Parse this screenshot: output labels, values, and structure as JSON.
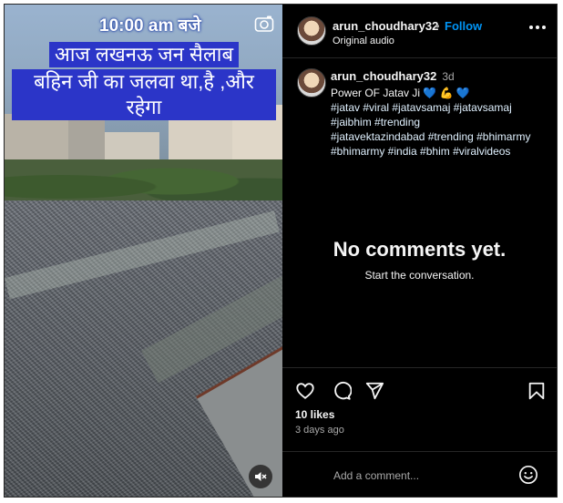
{
  "media": {
    "overlay_time": "10:00 am बजे",
    "caption_lines": [
      "आज लखनऊ जन सैलाब",
      "बहिन जी का जलवा था,है ,और रहेगा"
    ],
    "camera_icon": "camera-icon",
    "mute_icon": "speaker-muted-icon"
  },
  "header": {
    "username": "arun_choudhary32",
    "separator": "•",
    "follow_label": "Follow",
    "subtitle": "Original audio",
    "more_icon": "more-options-icon"
  },
  "caption": {
    "username": "arun_choudhary32",
    "time": "3d",
    "text": "Power OF Jatav Ji 💙 💪 💙",
    "hashtags": [
      "#jatav #viral #jatavsamaj #jatavsamaj",
      "#jaibhim #trending",
      "#jatavektazindabad #trending #bhimarmy",
      "#bhimarmy #india #bhim #viralvideos"
    ]
  },
  "comments": {
    "empty_title": "No comments yet.",
    "empty_subtitle": "Start the conversation."
  },
  "actions": {
    "like_icon": "heart-icon",
    "comment_icon": "comment-icon",
    "share_icon": "share-icon",
    "save_icon": "bookmark-icon",
    "likes": "10 likes",
    "time_ago": "3 days ago",
    "comment_placeholder": "Add a comment...",
    "emoji_icon": "emoji-icon"
  },
  "colors": {
    "accent": "#0095f6",
    "hashtag": "#e0f1ff",
    "caption_bg": "#2b35c8",
    "background": "#000000"
  }
}
